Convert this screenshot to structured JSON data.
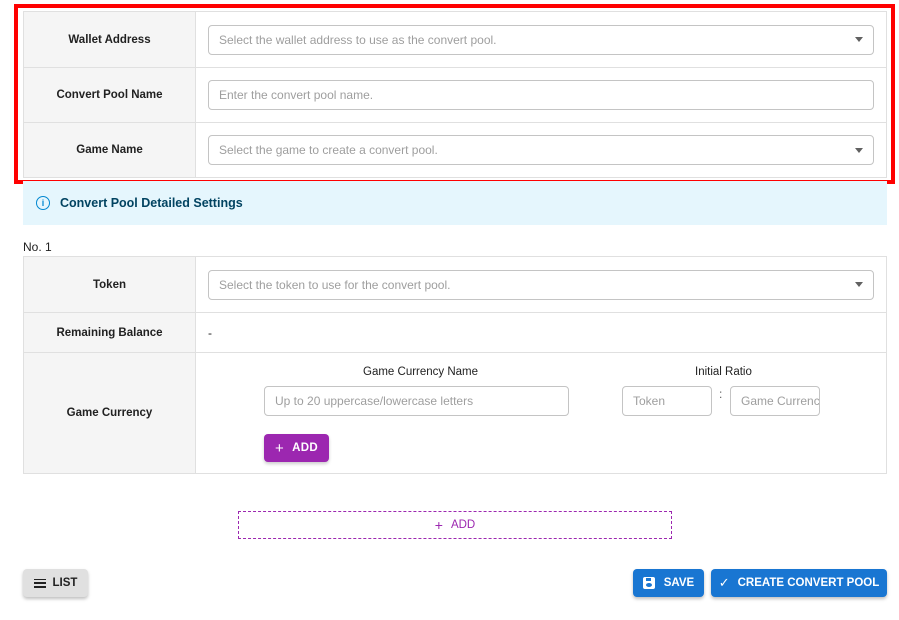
{
  "basic_form": {
    "wallet_address": {
      "label": "Wallet Address",
      "placeholder": "Select the wallet address to use as the convert pool."
    },
    "convert_pool_name": {
      "label": "Convert Pool Name",
      "placeholder": "Enter the convert pool name."
    },
    "game_name": {
      "label": "Game Name",
      "placeholder": "Select the game to create a convert pool."
    }
  },
  "detail_section": {
    "info_icon": "info-icon",
    "title": "Convert Pool Detailed Settings"
  },
  "pool_entry": {
    "number_label": "No. 1",
    "token": {
      "label": "Token",
      "placeholder": "Select the token to use for the convert pool."
    },
    "remaining_balance": {
      "label": "Remaining Balance",
      "value": "-"
    },
    "game_currency": {
      "label": "Game Currency",
      "name_header": "Game Currency Name",
      "name_placeholder": "Up to 20 uppercase/lowercase letters",
      "ratio_header": "Initial Ratio",
      "ratio_token_placeholder": "Token",
      "ratio_separator": ":",
      "ratio_currency_placeholder": "Game Currency",
      "add_button": "ADD"
    }
  },
  "add_pool_button": "ADD",
  "footer": {
    "list_button": "LIST",
    "save_button": "SAVE",
    "create_button": "CREATE CONVERT POOL"
  },
  "colors": {
    "highlight": "#ff0000",
    "primary": "#1976d2",
    "secondary": "#9c27b0",
    "info_bg": "#e5f6fd"
  }
}
